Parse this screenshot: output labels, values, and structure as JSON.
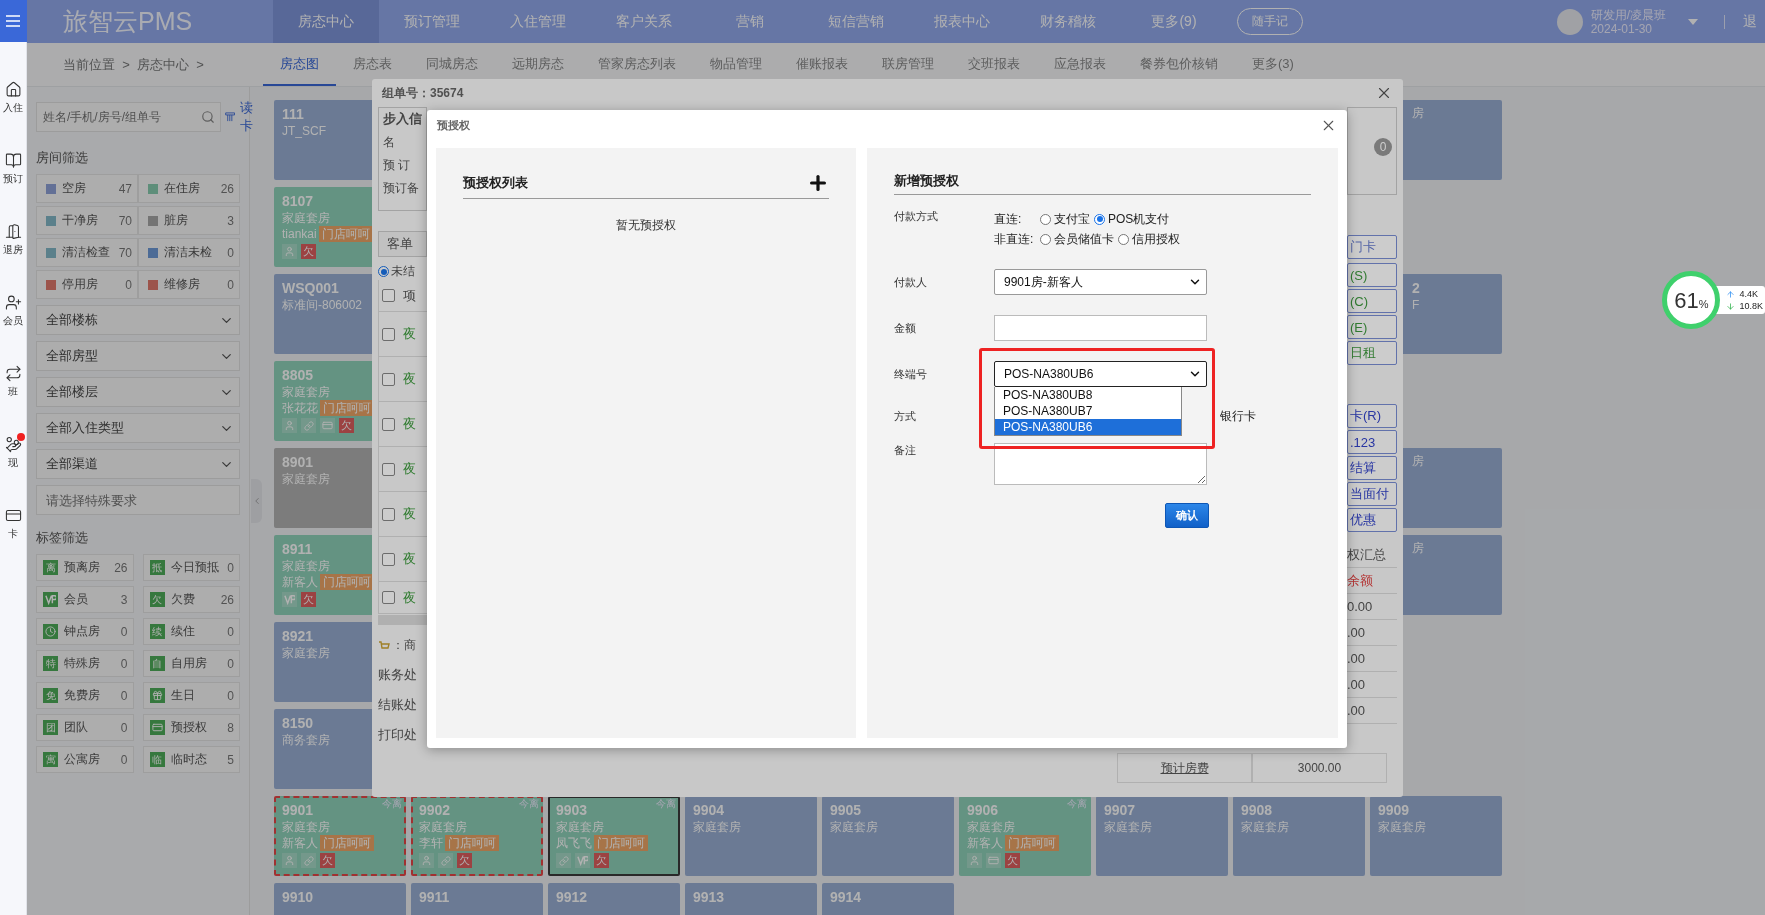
{
  "left_rail": {
    "items": [
      {
        "label": "入住",
        "kind": "home",
        "alert": false
      },
      {
        "label": "预订",
        "kind": "book",
        "alert": false
      },
      {
        "label": "退房",
        "kind": "door",
        "alert": false
      },
      {
        "label": "会员",
        "kind": "member",
        "alert": false
      },
      {
        "label": "班",
        "kind": "swap",
        "alert": false
      },
      {
        "label": "现",
        "kind": "cash",
        "alert": true
      },
      {
        "label": "卡",
        "kind": "card",
        "alert": false
      }
    ]
  },
  "top_bar": {
    "logo": "旅智云PMS",
    "menu": [
      {
        "label": "房态中心",
        "selected": true
      },
      {
        "label": "预订管理",
        "selected": false
      },
      {
        "label": "入住管理",
        "selected": false
      },
      {
        "label": "客户关系",
        "selected": false
      },
      {
        "label": "营销",
        "selected": false
      },
      {
        "label": "短信营销",
        "selected": false
      },
      {
        "label": "报表中心",
        "selected": false
      },
      {
        "label": "财务稽核",
        "selected": false
      },
      {
        "label": "更多(9)",
        "selected": false
      }
    ],
    "note_button": "随手记",
    "user": {
      "name": "研发用/凌晨班",
      "date": "2024-01-30"
    },
    "logout": "退"
  },
  "breadcrumb": "当前位置  >  房态中心  >",
  "sub_tabs": [
    {
      "label": "房态图",
      "selected": true
    },
    {
      "label": "房态表",
      "selected": false
    },
    {
      "label": "同城房态",
      "selected": false
    },
    {
      "label": "远期房态",
      "selected": false
    },
    {
      "label": "管家房态列表",
      "selected": false
    },
    {
      "label": "物品管理",
      "selected": false
    },
    {
      "label": "催账报表",
      "selected": false
    },
    {
      "label": "联房管理",
      "selected": false
    },
    {
      "label": "交班报表",
      "selected": false
    },
    {
      "label": "应急报表",
      "selected": false
    },
    {
      "label": "餐券包价核销",
      "selected": false
    },
    {
      "label": "更多(3)",
      "selected": false
    }
  ],
  "filters": {
    "search_placeholder": "姓名/手机/房号/组单号",
    "read_card": "读卡",
    "room_title": "房间筛选",
    "room_filters": [
      {
        "label": "空房",
        "count": "47",
        "kind": "vacant"
      },
      {
        "label": "在住房",
        "count": "26",
        "kind": "occupied"
      },
      {
        "label": "干净房",
        "count": "70",
        "kind": "clean"
      },
      {
        "label": "脏房",
        "count": "3",
        "kind": "dirty"
      },
      {
        "label": "清洁检查",
        "count": "70",
        "kind": "clean"
      },
      {
        "label": "清洁未检",
        "count": "0",
        "kind": "unchecked"
      },
      {
        "label": "停用房",
        "count": "0",
        "kind": "blocked"
      },
      {
        "label": "维修房",
        "count": "0",
        "kind": "blocked"
      }
    ],
    "selects": [
      "全部楼栋",
      "全部房型",
      "全部楼层",
      "全部入住类型",
      "全部渠道"
    ],
    "special_placeholder": "请选择特殊要求",
    "tag_title": "标签筛选",
    "tag_filters": [
      {
        "kind": "char",
        "badge": "离",
        "label": "预离房",
        "count": "26"
      },
      {
        "kind": "char",
        "badge": "抵",
        "label": "今日预抵",
        "count": "0"
      },
      {
        "kind": "vip",
        "label": "会员",
        "count": "3"
      },
      {
        "kind": "char",
        "badge": "欠",
        "label": "欠费",
        "count": "26"
      },
      {
        "kind": "clock",
        "label": "钟点房",
        "count": "0"
      },
      {
        "kind": "char",
        "badge": "续",
        "label": "续住",
        "count": "0"
      },
      {
        "kind": "char",
        "badge": "特",
        "label": "特殊房",
        "count": "0"
      },
      {
        "kind": "char",
        "badge": "自",
        "label": "自用房",
        "count": "0"
      },
      {
        "kind": "char",
        "badge": "免",
        "label": "免费房",
        "count": "0"
      },
      {
        "kind": "gift",
        "label": "生日",
        "count": "0"
      },
      {
        "kind": "char",
        "badge": "团",
        "label": "团队",
        "count": "0"
      },
      {
        "kind": "card",
        "label": "预授权",
        "count": "8"
      },
      {
        "kind": "char",
        "badge": "寓",
        "label": "公寓房",
        "count": "0"
      },
      {
        "kind": "char",
        "badge": "临",
        "label": "临时态",
        "count": "5"
      }
    ]
  },
  "room_grid": {
    "left_column": [
      {
        "kind": "vacant",
        "number": "111",
        "type": "JT_SCF"
      },
      {
        "kind": "occupied",
        "number": "8107",
        "type": "家庭套房",
        "guest": "tiankai",
        "tag": "门店呵呵",
        "icons": [
          {
            "kind": "person"
          },
          {
            "kind": "debt",
            "text": "欠"
          }
        ]
      },
      {
        "kind": "vacant",
        "number": "WSQ001",
        "type": "标准间-806002"
      },
      {
        "kind": "occupied",
        "number": "8805",
        "type": "家庭套房",
        "guest": "张花花",
        "tag": "门店呵呵",
        "icons": [
          {
            "kind": "person"
          },
          {
            "kind": "link"
          },
          {
            "kind": "card"
          },
          {
            "kind": "debt",
            "text": "欠"
          }
        ]
      },
      {
        "kind": "dirty",
        "number": "8901",
        "type": "家庭套房"
      },
      {
        "kind": "occupied",
        "number": "8911",
        "type": "家庭套房",
        "guest": "新客人",
        "tag": "门店呵呵",
        "icons": [
          {
            "kind": "vip"
          },
          {
            "kind": "debt",
            "text": "欠"
          }
        ]
      },
      {
        "kind": "vacant",
        "number": "8921",
        "type": "家庭套房"
      },
      {
        "kind": "vacant",
        "number": "8150",
        "type": "商务套房"
      }
    ],
    "right_column": [
      {
        "kind": "vacant",
        "type": "房"
      },
      {
        "kind": "vacant",
        "number": "2",
        "type": "F"
      },
      {
        "kind": "vacant",
        "type": "房"
      },
      {
        "kind": "vacant",
        "type": "房"
      }
    ],
    "bottom_row": [
      {
        "kind": "occupied",
        "number": "9901",
        "type": "家庭套房",
        "guest": "新客人",
        "tag": "门店呵呵",
        "corner": "今离",
        "flagged": true,
        "active": false,
        "icons": [
          {
            "kind": "person"
          },
          {
            "kind": "link"
          },
          {
            "kind": "debt",
            "text": "欠"
          }
        ]
      },
      {
        "kind": "occupied",
        "number": "9902",
        "type": "家庭套房",
        "guest": "李轩",
        "tag": "门店呵呵",
        "corner": "今离",
        "flagged": true,
        "active": false,
        "icons": [
          {
            "kind": "person"
          },
          {
            "kind": "link"
          },
          {
            "kind": "debt",
            "text": "欠"
          }
        ]
      },
      {
        "kind": "occupied",
        "number": "9903",
        "type": "家庭套房",
        "guest": "凤飞飞",
        "tag": "门店呵呵",
        "corner": "今离",
        "flagged": false,
        "active": true,
        "icons": [
          {
            "kind": "link"
          },
          {
            "kind": "vip"
          },
          {
            "kind": "debt",
            "text": "欠"
          }
        ]
      },
      {
        "kind": "vacant",
        "number": "9904",
        "type": "家庭套房",
        "flagged": false,
        "active": false
      },
      {
        "kind": "vacant",
        "number": "9905",
        "type": "家庭套房",
        "flagged": false,
        "active": false
      },
      {
        "kind": "occupied",
        "number": "9906",
        "type": "家庭套房",
        "guest": "新客人",
        "tag": "门店呵呵",
        "corner": "今离",
        "flagged": false,
        "active": false,
        "icons": [
          {
            "kind": "person"
          },
          {
            "kind": "card"
          },
          {
            "kind": "debt",
            "text": "欠"
          }
        ]
      },
      {
        "kind": "vacant",
        "number": "9907",
        "type": "家庭套房",
        "flagged": false,
        "active": false
      },
      {
        "kind": "vacant",
        "number": "9908",
        "type": "家庭套房",
        "flagged": false,
        "active": false
      },
      {
        "kind": "vacant",
        "number": "9909",
        "type": "家庭套房",
        "flagged": false,
        "active": false
      }
    ],
    "last_row": [
      {
        "kind": "vacant",
        "number": "9910"
      },
      {
        "kind": "vacant",
        "number": "9911"
      },
      {
        "kind": "vacant",
        "number": "9912"
      },
      {
        "kind": "vacant",
        "number": "9913"
      },
      {
        "kind": "vacant",
        "number": "9914"
      }
    ]
  },
  "order_dialog": {
    "title": "组单号：35674",
    "left": {
      "legend": "步入信",
      "info": [
        "名",
        "预 订",
        "预订备"
      ],
      "tab": "客单",
      "radio": {
        "label": "未结",
        "selected": true
      },
      "header": "项",
      "header_checked": false,
      "rows": [
        {
          "text": "夜",
          "checked": false
        },
        {
          "text": "夜",
          "checked": false
        },
        {
          "text": "夜",
          "checked": false
        },
        {
          "text": "夜",
          "checked": false
        },
        {
          "text": "夜",
          "checked": false
        },
        {
          "text": "夜",
          "checked": false
        },
        {
          "text": "夜",
          "checked": false
        }
      ],
      "goods": "：商",
      "actions": [
        "账务处",
        "结账处",
        "打印处"
      ]
    },
    "right": {
      "badge": "0",
      "buttons": [
        {
          "label": "门卡",
          "kind": "card"
        },
        {
          "label": "(S)",
          "kind": "stay"
        },
        {
          "label": "(C)",
          "kind": "stay"
        },
        {
          "label": "(E)",
          "kind": "stay"
        },
        {
          "label": "日租",
          "kind": "stay"
        },
        {
          "label": "卡(R)",
          "kind": "pay"
        },
        {
          "label": ".123",
          "kind": "pay"
        },
        {
          "label": "结算",
          "kind": "pay"
        },
        {
          "label": "当面付",
          "kind": "pay"
        },
        {
          "label": "优惠",
          "kind": "pay"
        }
      ],
      "summary_title": "权汇总",
      "summary_head": "余额",
      "amounts": [
        "0.00",
        ".00",
        ".00",
        ".00",
        ".00"
      ]
    },
    "footer": {
      "label": "预计房费",
      "value": "3000.00"
    }
  },
  "preauth_dialog": {
    "title": "预授权",
    "list": {
      "title": "预授权列表",
      "empty": "暂无预授权"
    },
    "form": {
      "title": "新增预授权",
      "payment": {
        "label": "付款方式",
        "direct_label": "直连:",
        "direct": [
          {
            "label": "支付宝",
            "selected": false
          },
          {
            "label": "POS机支付",
            "selected": true
          }
        ],
        "indirect_label": "非直连:",
        "indirect": [
          {
            "label": "会员储值卡",
            "selected": false
          },
          {
            "label": "信用授权",
            "selected": false
          }
        ]
      },
      "payer": {
        "label": "付款人",
        "value": "9901房-新客人"
      },
      "amount": {
        "label": "金额"
      },
      "terminal": {
        "label": "终端号",
        "value": "POS-NA380UB6",
        "options": [
          {
            "label": "POS-NA380UB8",
            "selected": false
          },
          {
            "label": "POS-NA380UB7",
            "selected": false
          },
          {
            "label": "POS-NA380UB6",
            "selected": true
          }
        ]
      },
      "method": {
        "label": "方式",
        "option": "银行卡"
      },
      "remark": {
        "label": "备注"
      },
      "confirm": "确认"
    }
  },
  "network_widget": {
    "percent": "61",
    "unit": "%",
    "upload": "4.4K",
    "download": "10.8K"
  }
}
